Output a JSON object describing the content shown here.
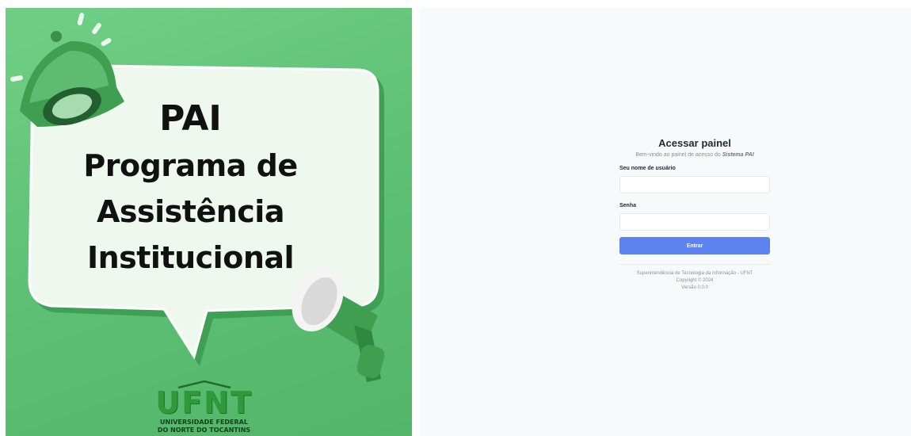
{
  "banner": {
    "acronym": "PAI",
    "lines": [
      "Programa de",
      "Assistência",
      "Institucional"
    ],
    "logo": {
      "wordmark": "UFNT",
      "line1": "UNIVERSIDADE FEDERAL",
      "line2": "DO NORTE DO TOCANTINS"
    }
  },
  "login": {
    "title": "Acessar painel",
    "subtitle_prefix": "Bem-vindo ao painel de acesso do",
    "subtitle_system": "Sistema PAI",
    "username_label": "Seu nome de usuário",
    "username_value": "",
    "password_label": "Senha",
    "password_value": "",
    "submit_label": "Entrar"
  },
  "footer": {
    "org": "Superintendência de Tecnologia da Informação - UFNT",
    "copyright": "Copyright © 2024",
    "version": "Versão 0.0.0"
  },
  "colors": {
    "banner_green": "#5cbf73",
    "primary_button": "#5b82ef",
    "panel_background": "#f8f9fb"
  }
}
